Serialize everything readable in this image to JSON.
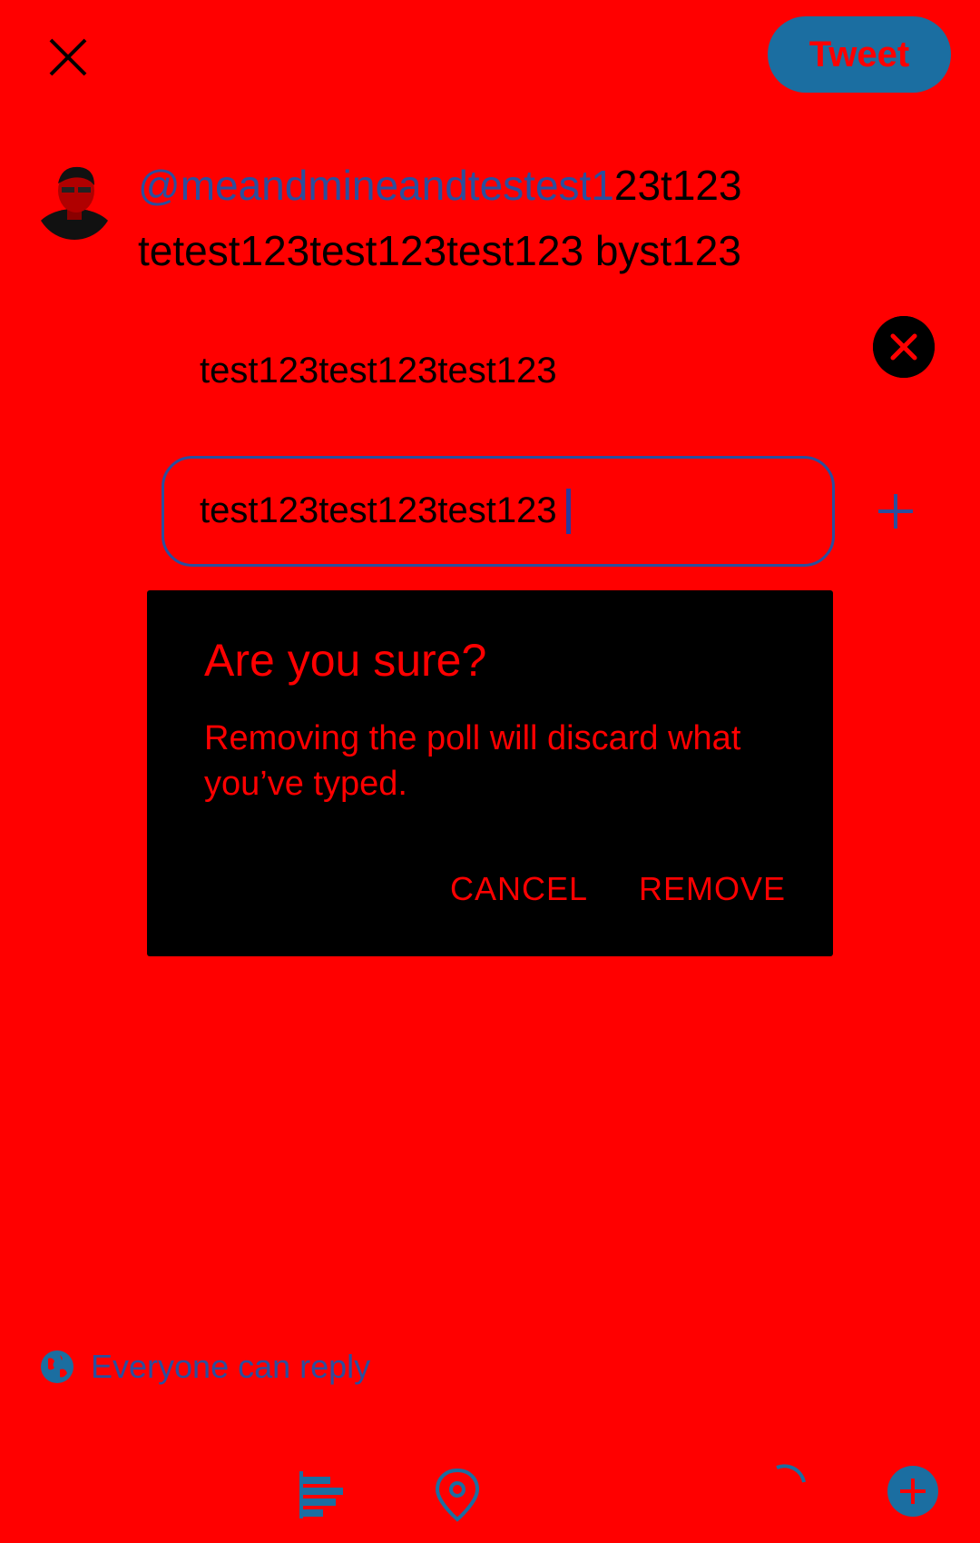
{
  "header": {
    "tweet_label": "Tweet"
  },
  "composer": {
    "mention_prefix": "@meandmineandtestest1",
    "mention_rest": "23t123",
    "second_line": "tetest123test123test123 byst123"
  },
  "poll": {
    "choice1": "test123test123test123",
    "choice2": "test123test123test123"
  },
  "dialog": {
    "title": "Are you sure?",
    "message": "Removing the poll will discard what you’ve typed.",
    "cancel_label": "CANCEL",
    "remove_label": "REMOVE"
  },
  "footer": {
    "reply_setting": "Everyone can reply"
  },
  "colors": {
    "background": "#ff0000",
    "accent": "#1b6ea1",
    "mention": "#2a4f9e",
    "dialog_bg": "#000000"
  }
}
